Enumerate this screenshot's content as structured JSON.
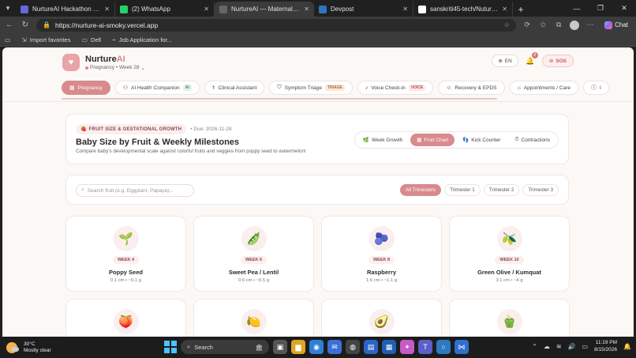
{
  "browser": {
    "tabs": [
      {
        "label": "NurtureAI Hackathon Guidance",
        "favicon": "document-icon",
        "color": "#5f6bd8",
        "active": false
      },
      {
        "label": "(2) WhatsApp",
        "favicon": "whatsapp-icon",
        "color": "#25d366",
        "active": false
      },
      {
        "label": "NurtureAI — Maternal Health, Fetal",
        "favicon": "globe-icon",
        "color": "#666666",
        "active": true
      },
      {
        "label": "Devpost",
        "favicon": "devpost-icon",
        "color": "#2f74c0",
        "active": false
      },
      {
        "label": "sanskriti45-tech/Nuture--AI: Nurtu",
        "favicon": "github-icon",
        "color": "#ffffff",
        "active": false
      }
    ],
    "url": "https://nurture-ai-smoky.vercel.app",
    "chat_label": "Chat",
    "bookmarks": [
      {
        "label": "Import favorites",
        "icon": "import-icon"
      },
      {
        "label": "Dell",
        "icon": "folder-icon"
      },
      {
        "label": "Job Application for...",
        "icon": "link-icon"
      }
    ]
  },
  "app": {
    "brand_main": "Nurture",
    "brand_ai": "AI",
    "subtitle": "Pregnancy • Week 28",
    "lang": "EN",
    "notification_count": "2",
    "sos_label": "SOS",
    "nav": [
      {
        "label": "Pregnancy",
        "icon": "grid-icon",
        "active": true,
        "tag": ""
      },
      {
        "label": "AI Health Companion",
        "icon": "robot-icon",
        "active": false,
        "tag": "AI"
      },
      {
        "label": "Clinical Assistant",
        "icon": "stethoscope-icon",
        "active": false,
        "tag": ""
      },
      {
        "label": "Symptom Triage",
        "icon": "shield-icon",
        "active": false,
        "tag": "TRIAGE"
      },
      {
        "label": "Voice Check-in",
        "icon": "mic-icon",
        "active": false,
        "tag": "VOICE"
      },
      {
        "label": "Recovery & EPDS",
        "icon": "smile-icon",
        "active": false,
        "tag": ""
      },
      {
        "label": "Appointments / Care",
        "icon": "tag-icon",
        "active": false,
        "tag": ""
      },
      {
        "label": "I",
        "icon": "info-icon",
        "active": false,
        "tag": ""
      }
    ],
    "hero": {
      "chip": "FRUIT SIZE & GESTATIONAL GROWTH",
      "due": "• Due: 2026-11-28",
      "title": "Baby Size by Fruit & Weekly Milestones",
      "description": "Compare baby's developmental scale against colorful fruits and veggies from poppy seed to watermelon!",
      "views": [
        {
          "label": "Week Growth",
          "icon": "leaf-icon",
          "active": false
        },
        {
          "label": "Fruit Chart",
          "icon": "chart-icon",
          "active": true
        },
        {
          "label": "Kick Counter",
          "icon": "foot-icon",
          "active": false
        },
        {
          "label": "Contractions",
          "icon": "timer-icon",
          "active": false
        }
      ]
    },
    "search_placeholder": "Search fruit (e.g. Eggplant, Papaya)...",
    "trimesters": [
      {
        "label": "All Trimesters",
        "active": true
      },
      {
        "label": "Trimester 1",
        "active": false
      },
      {
        "label": "Trimester 2",
        "active": false
      },
      {
        "label": "Trimester 3",
        "active": false
      }
    ],
    "fruits": [
      {
        "week": "WEEK 4",
        "name": "Poppy Seed",
        "size": "0.1 cm • ~0.1 g",
        "emoji": "🌱"
      },
      {
        "week": "WEEK 6",
        "name": "Sweet Pea / Lentil",
        "size": "0.6 cm • ~0.5 g",
        "emoji": "🫛"
      },
      {
        "week": "WEEK 8",
        "name": "Raspberry",
        "size": "1.6 cm • ~1.1 g",
        "emoji": "🫐"
      },
      {
        "week": "WEEK 10",
        "name": "Green Olive / Kumquat",
        "size": "3.1 cm • ~4 g",
        "emoji": "🫒"
      },
      {
        "week": "",
        "name": "",
        "size": "",
        "emoji": "🍑"
      },
      {
        "week": "",
        "name": "",
        "size": "",
        "emoji": "🍋"
      },
      {
        "week": "",
        "name": "",
        "size": "",
        "emoji": "🥑"
      },
      {
        "week": "",
        "name": "",
        "size": "",
        "emoji": "🫑"
      }
    ]
  },
  "taskbar": {
    "temp": "30°C",
    "weather": "Mostly clear",
    "search_label": "Search",
    "time": "11:19 PM",
    "date": "8/15/2026"
  }
}
